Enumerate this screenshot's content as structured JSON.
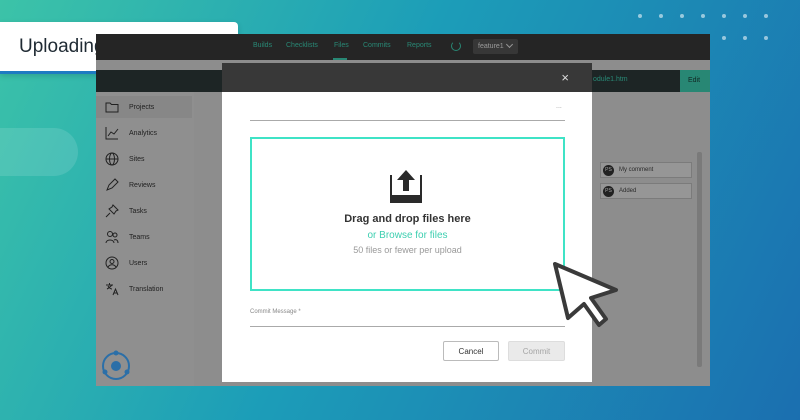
{
  "banner": {
    "title": "Uploading Existing Files",
    "accent": "#1e7bc2"
  },
  "app": {
    "nav": [
      {
        "label": "Builds"
      },
      {
        "label": "Checklists"
      },
      {
        "label": "Files",
        "active": true
      },
      {
        "label": "Commits"
      },
      {
        "label": "Reports"
      }
    ],
    "branch": "feature1",
    "file_name": "odule1.htm",
    "edit_label": "Edit",
    "sidebar": [
      {
        "label": "Projects",
        "icon": "folder-icon",
        "active": true
      },
      {
        "label": "Analytics",
        "icon": "chart-icon"
      },
      {
        "label": "Sites",
        "icon": "globe-icon"
      },
      {
        "label": "Reviews",
        "icon": "pen-icon"
      },
      {
        "label": "Tasks",
        "icon": "pin-icon"
      },
      {
        "label": "Teams",
        "icon": "team-icon"
      },
      {
        "label": "Users",
        "icon": "user-icon"
      },
      {
        "label": "Translation",
        "icon": "translate-icon"
      }
    ],
    "comments": [
      {
        "initials": "PS",
        "text": "My comment"
      },
      {
        "initials": "PS",
        "text": "Added"
      }
    ],
    "accent": "#3ed0b3"
  },
  "modal": {
    "close_glyph": "×",
    "ellipsis": "...",
    "dropzone": {
      "title": "Drag and drop files here",
      "browse": "or Browse for files",
      "limit": "50 files or fewer per upload",
      "border_color": "#3fe3c6"
    },
    "commit_label": "Commit Message *",
    "commit_value": "",
    "cancel_label": "Cancel",
    "commit_button_label": "Commit"
  }
}
